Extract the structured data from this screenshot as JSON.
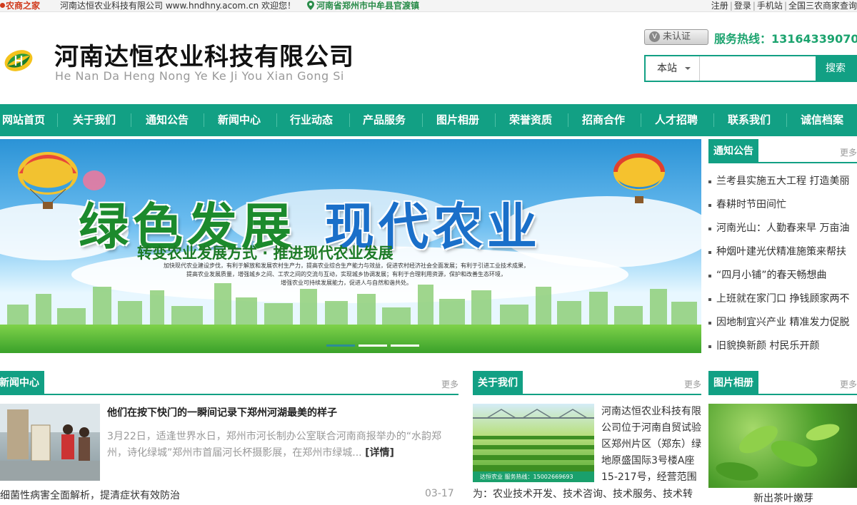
{
  "topbar": {
    "brand": "农商之家",
    "welcome": "河南达恒农业科技有限公司 www.hndhny.acom.cn 欢迎您！",
    "location": "河南省郑州市中牟县官渡镇",
    "links": [
      "注册",
      "登录",
      "手机站",
      "全国三农商家查询"
    ]
  },
  "header": {
    "company_name": "河南达恒农业科技有限公司",
    "pinyin": "He Nan Da Heng Nong Ye Ke Ji You Xian Gong Si",
    "cert_label": "未认证",
    "hotline": "服务热线：13164339070"
  },
  "search": {
    "scope": "本站",
    "placeholder": "",
    "button": "搜索"
  },
  "nav": [
    "网站首页",
    "关于我们",
    "通知公告",
    "新闻中心",
    "行业动态",
    "产品服务",
    "图片相册",
    "荣誉资质",
    "招商合作",
    "人才招聘",
    "联系我们",
    "诚信档案"
  ],
  "banner": {
    "headline_left": "绿色发展",
    "headline_right": "现代农业",
    "subtitle": "转变农业发展方式 · 推进现代农业发展",
    "body_line1": "加快现代农业建设步伐，有利于解放和发展农村生产力，提高农业综合生产能力与效益，促进农村经济社会全面发展；有利于引进工业技术成果，",
    "body_line2": "提高农业发展质量，增强城乡之间、工农之间的交流与互动，实现城乡协调发展；有利于合理利用资源，保护和改善生态环境，",
    "body_line3": "增强农业可持续发展能力，促进人与自然和谐共处。"
  },
  "notice": {
    "title": "通知公告",
    "more": "更多",
    "items": [
      "兰考县实施五大工程 打造美丽",
      "春耕时节田间忙",
      "河南光山：人勤春来早 万亩油",
      "种烟叶建光伏精准施策来帮扶",
      "“四月小铺”的春天畅想曲",
      "上班就在家门口 挣钱顾家两不",
      "因地制宜兴产业 精准发力促脱",
      "旧貌换新颜 村民乐开颜"
    ]
  },
  "news": {
    "title": "新闻中心",
    "more": "更多",
    "headline": "他们在按下快门的一瞬间记录下郑州河湖最美的样子",
    "summary": "3月22日，适逢世界水日，郑州市河长制办公室联合河南商报举办的“水韵郑州，诗化绿城”郑州市首届河长杯摄影展，在郑州市绿城...",
    "detail": "[详情]",
    "item2": "细菌性病害全面解析，提清症状有效防治",
    "item2_date": "03-17"
  },
  "about": {
    "title": "关于我们",
    "more": "更多",
    "text": "河南达恒农业科技有限公司位于河南自贸试验区郑州片区（郑东）绿地原盛国际3号楼A座15-217号，经营范围",
    "text2": "为：农业技术开发、技术咨询、技术服务、技术转",
    "img_caption": "达恒农业  服务热线：15002669693"
  },
  "photo": {
    "title": "图片相册",
    "more": "更多",
    "caption": "新出茶叶嫩芽"
  }
}
